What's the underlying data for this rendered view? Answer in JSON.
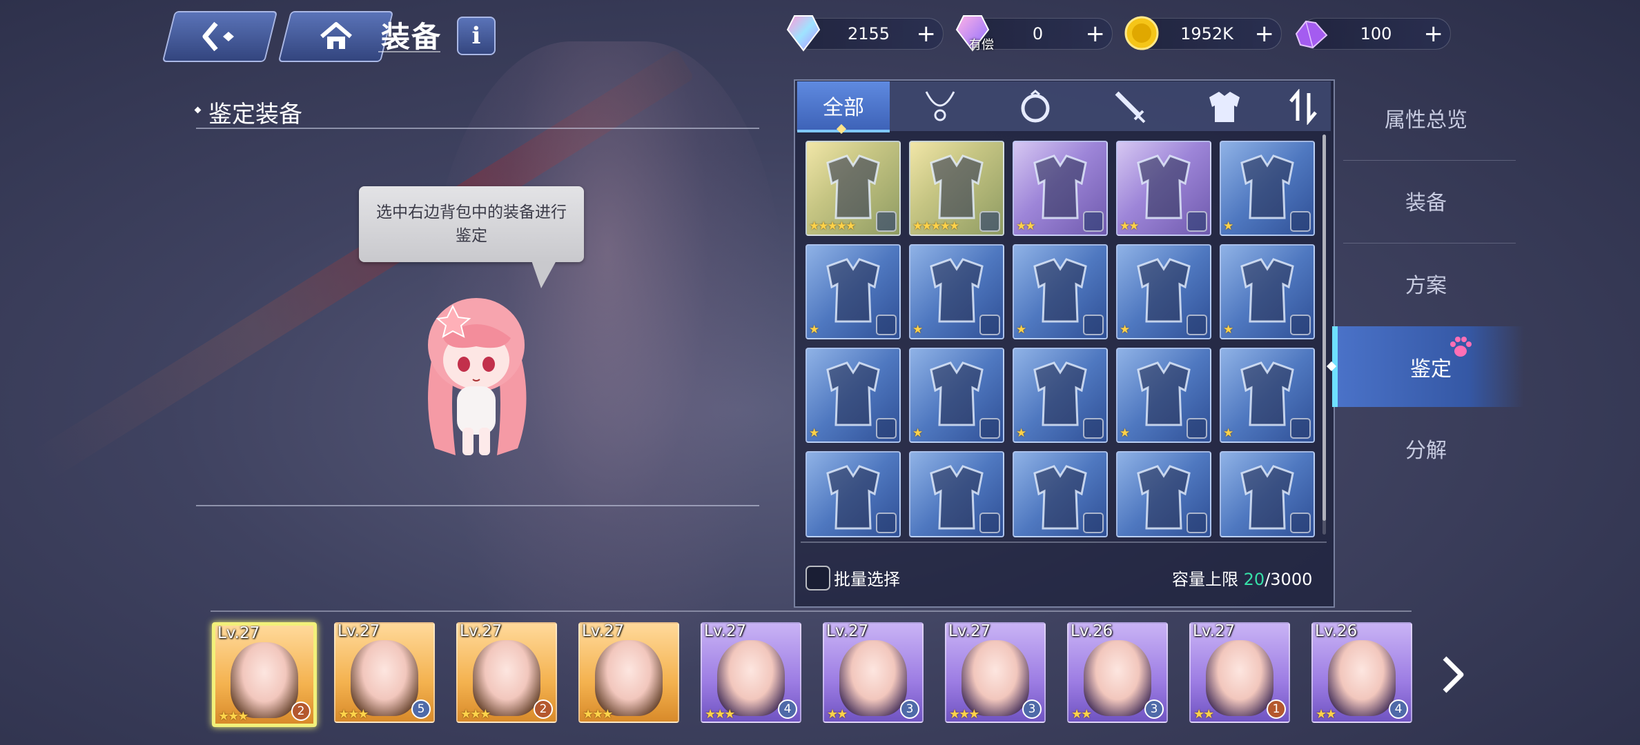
{
  "header": {
    "title": "装备",
    "back_icon": "back-arrow-icon",
    "home_icon": "home-icon",
    "info_label": "i"
  },
  "currencies": [
    {
      "name": "crystal",
      "icon": "rainbow-crystal-icon",
      "value": "2155",
      "sub": ""
    },
    {
      "name": "paid-crystal",
      "icon": "paid-crystal-icon",
      "value": "0",
      "sub": "有偿"
    },
    {
      "name": "gold",
      "icon": "gold-coin-icon",
      "value": "1952K",
      "sub": ""
    },
    {
      "name": "purple-crystal",
      "icon": "purple-crystal-icon",
      "value": "100",
      "sub": ""
    }
  ],
  "left_panel": {
    "title": "鉴定装备",
    "speech": "选中右边背包中的装备进行鉴定"
  },
  "inventory": {
    "tabs": [
      "全部",
      "necklace-icon",
      "ring-icon",
      "weapon-icon",
      "armor-icon",
      "sort-icon"
    ],
    "active_tab": "全部",
    "items": [
      {
        "type": "gold",
        "stars": "★★★★★"
      },
      {
        "type": "gold",
        "stars": "★★★★★"
      },
      {
        "type": "purple",
        "stars": "★★"
      },
      {
        "type": "purple",
        "stars": "★★"
      },
      {
        "type": "blue",
        "stars": "★"
      },
      {
        "type": "blue",
        "stars": "★"
      },
      {
        "type": "blue",
        "stars": "★"
      },
      {
        "type": "blue",
        "stars": "★"
      },
      {
        "type": "blue",
        "stars": "★"
      },
      {
        "type": "blue",
        "stars": "★"
      },
      {
        "type": "blue",
        "stars": "★"
      },
      {
        "type": "blue",
        "stars": "★"
      },
      {
        "type": "blue",
        "stars": "★"
      },
      {
        "type": "blue",
        "stars": "★"
      },
      {
        "type": "blue",
        "stars": "★"
      },
      {
        "type": "blue",
        "stars": ""
      },
      {
        "type": "blue",
        "stars": ""
      },
      {
        "type": "blue",
        "stars": ""
      },
      {
        "type": "blue",
        "stars": ""
      },
      {
        "type": "blue",
        "stars": ""
      }
    ],
    "batch_label": "批量选择",
    "capacity_label": "容量上限 ",
    "capacity_current": "20",
    "capacity_max": "/3000"
  },
  "side_menu": {
    "items": [
      "属性总览",
      "装备",
      "方案",
      "鉴定",
      "分解"
    ],
    "active": "鉴定"
  },
  "roster": [
    {
      "lv": "Lv.27",
      "rarity": "gold",
      "stars": "★★★",
      "badge": "2",
      "badge_color": "brown",
      "selected": true
    },
    {
      "lv": "Lv.27",
      "rarity": "gold",
      "stars": "★★★",
      "badge": "5",
      "badge_color": "blue",
      "selected": false
    },
    {
      "lv": "Lv.27",
      "rarity": "gold",
      "stars": "★★★",
      "badge": "2",
      "badge_color": "brown",
      "selected": false
    },
    {
      "lv": "Lv.27",
      "rarity": "gold",
      "stars": "★★★",
      "badge": "",
      "badge_color": "",
      "selected": false
    },
    {
      "lv": "Lv.27",
      "rarity": "purple",
      "stars": "★★★",
      "badge": "4",
      "badge_color": "blue",
      "selected": false
    },
    {
      "lv": "Lv.27",
      "rarity": "purple",
      "stars": "★★",
      "badge": "3",
      "badge_color": "blue",
      "selected": false
    },
    {
      "lv": "Lv.27",
      "rarity": "purple",
      "stars": "★★★",
      "badge": "3",
      "badge_color": "blue",
      "selected": false
    },
    {
      "lv": "Lv.26",
      "rarity": "purple",
      "stars": "★★",
      "badge": "3",
      "badge_color": "blue",
      "selected": false
    },
    {
      "lv": "Lv.27",
      "rarity": "purple",
      "stars": "★★",
      "badge": "1",
      "badge_color": "brown",
      "selected": false
    },
    {
      "lv": "Lv.26",
      "rarity": "purple",
      "stars": "★★",
      "badge": "4",
      "badge_color": "blue",
      "selected": false
    }
  ],
  "colors": {
    "accent": "#3e63b8",
    "capacity_current": "#37e0a8",
    "selected_border": "#f2f07a"
  }
}
